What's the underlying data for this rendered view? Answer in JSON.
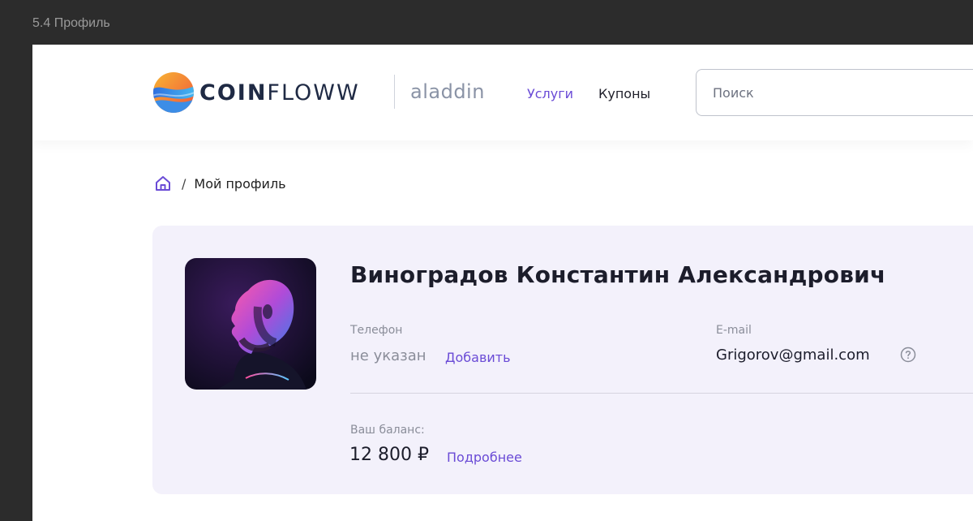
{
  "window": {
    "title": "5.4 Профиль"
  },
  "header": {
    "logo_bold": "COIN",
    "logo_light": "FLOWW",
    "partner": "aladdin",
    "nav": [
      {
        "label": "Услуги",
        "active": true
      },
      {
        "label": "Купоны",
        "active": false
      }
    ],
    "search": {
      "placeholder": "Поиск",
      "value": ""
    }
  },
  "breadcrumb": {
    "home_icon": "home-icon",
    "separator": "/",
    "current": "Мой профиль"
  },
  "profile": {
    "full_name": "Виноградов Константин Александрович",
    "phone": {
      "label": "Телефон",
      "value": "не указан",
      "action": "Добавить"
    },
    "email": {
      "label": "E-mail",
      "value": "Grigorov@gmail.com",
      "help_icon": "question-circle-icon"
    },
    "balance": {
      "label": "Ваш баланс:",
      "value": "12 800 ₽",
      "action": "Подробнее"
    }
  },
  "colors": {
    "accent": "#6a4bd6",
    "card_bg": "#f3f1fb",
    "text_primary": "#1c1d2b",
    "text_muted": "#8a8d99",
    "window_chrome": "#2c2c2c"
  }
}
